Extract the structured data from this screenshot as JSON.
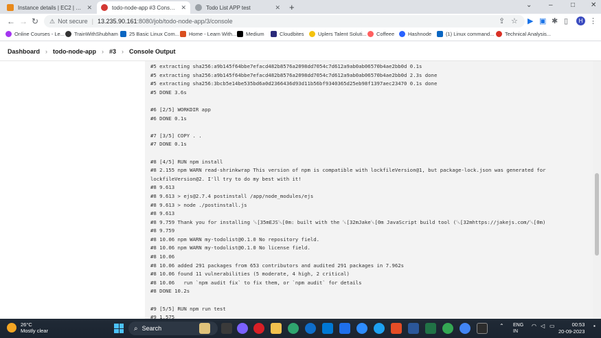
{
  "browser": {
    "tabs": [
      {
        "title": "Instance details | EC2 | ap-south",
        "icon": "aws-icon",
        "color": "#e8891b",
        "active": false
      },
      {
        "title": "todo-node-app #3 Console [Jenl",
        "icon": "jenkins-icon",
        "color": "#d33833",
        "active": true
      },
      {
        "title": "Todo List APP test",
        "icon": "globe-icon",
        "color": "#5f6368",
        "active": false
      }
    ],
    "new_tab": "+",
    "window_controls": {
      "chevron": "⌄",
      "minimize": "–",
      "maximize": "□",
      "close": "✕"
    },
    "address": {
      "security_label": "Not secure",
      "host": "13.235.90.161",
      "path": ":8080/job/todo-node-app/3/console"
    },
    "profile_initial": "H"
  },
  "bookmarks": [
    {
      "label": "Online Courses - Le...",
      "color": "#a435f0"
    },
    {
      "label": "TrainWithShubham",
      "color": "#333333"
    },
    {
      "label": "25 Basic Linux Com...",
      "color": "#0a66c2"
    },
    {
      "label": "Home - Learn With...",
      "color": "#d94f1e"
    },
    {
      "label": "Medium",
      "color": "#000000"
    },
    {
      "label": "Cloudbites",
      "color": "#2a2a7a"
    },
    {
      "label": "Uplers Talent Soluti...",
      "color": "#f4c20d"
    },
    {
      "label": "Coffeee",
      "color": "#ff5f5f"
    },
    {
      "label": "Hashnode",
      "color": "#2962ff"
    },
    {
      "label": "(1) Linux command...",
      "color": "#0a66c2"
    },
    {
      "label": "Technical Analysis...",
      "color": "#d93025"
    }
  ],
  "breadcrumb": {
    "items": [
      "Dashboard",
      "todo-node-app",
      "#3",
      "Console Output"
    ],
    "separator": "›"
  },
  "console": {
    "lines": [
      "#5 extracting sha256:a9b145f64bbe7efacd482b8576a2098dd7054c7d612a9ab0ab06570b4ae2bb0d 0.1s",
      "#5 extracting sha256:a9b145f64bbe7efacd482b8576a2098dd7054c7d612a9ab0ab06570b4ae2bb0d 2.3s done",
      "#5 extracting sha256:3bcb5e14be535bd6a0d2366436d93d11b56bf9340365d25eb98f1397aec23470 0.1s done",
      "#5 DONE 3.6s",
      "",
      "#6 [2/5] WORKDIR app",
      "#6 DONE 0.1s",
      "",
      "#7 [3/5] COPY . .",
      "#7 DONE 0.1s",
      "",
      "#8 [4/5] RUN npm install",
      "#8 2.155 npm WARN read-shrinkwrap This version of npm is compatible with lockfileVersion@1, but package-lock.json was generated for",
      "lockfileVersion@2. I'll try to do my best with it!",
      "#8 9.613",
      "#8 9.613 > ejs@2.7.4 postinstall /app/node_modules/ejs",
      "#8 9.613 > node ./postinstall.js",
      "#8 9.613",
      "#8 9.759 Thank you for installing ␛[35mEJS␛[0m: built with the ␛[32mJake␛[0m JavaScript build tool (␛[32mhttps://jakejs.com/␛[0m)",
      "#8 9.759",
      "#8 10.06 npm WARN my-todolist@0.1.0 No repository field.",
      "#8 10.06 npm WARN my-todolist@0.1.0 No license field.",
      "#8 10.06",
      "#8 10.06 added 291 packages from 653 contributors and audited 291 packages in 7.962s",
      "#8 10.06 found 11 vulnerabilities (5 moderate, 4 high, 2 critical)",
      "#8 10.06   run `npm audit fix` to fix them, or `npm audit` for details",
      "#8 DONE 10.2s",
      "",
      "#9 [5/5] RUN npm run test",
      "#9 1.575"
    ]
  },
  "taskbar": {
    "weather": {
      "temp": "26°C",
      "condition": "Mostly clear"
    },
    "search_label": "Search",
    "language": {
      "line1": "ENG",
      "line2": "IN"
    },
    "clock": {
      "time": "00:53",
      "date": "20-09-2023"
    }
  }
}
